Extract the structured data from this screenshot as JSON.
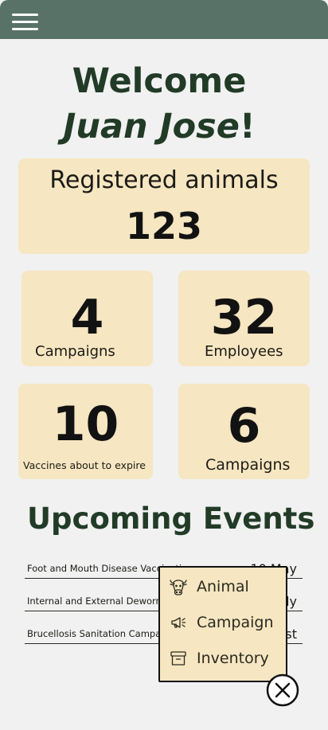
{
  "header": {
    "menu_icon": "hamburger-menu-icon"
  },
  "welcome": {
    "line1": "Welcome",
    "name": "Juan Jose",
    "punct": "!"
  },
  "stats": {
    "registered": {
      "label": "Registered animals",
      "value": "123"
    },
    "campaigns_a": {
      "value": "4",
      "label": "Campaigns"
    },
    "employees": {
      "value": "32",
      "label": "Employees"
    },
    "vaccines": {
      "value": "10",
      "label": "Vaccines about to expire"
    },
    "campaigns_b": {
      "value": "6",
      "label": "Campaigns"
    }
  },
  "events": {
    "title": "Upcoming Events",
    "rows": [
      {
        "name": "Foot and Mouth Disease Vaccination",
        "date": "10 May"
      },
      {
        "name": "Internal and External Deworming",
        "date": "July"
      },
      {
        "name": "Brucellosis Sanitation Campaign",
        "date": "August"
      }
    ]
  },
  "popup": {
    "items": [
      {
        "label": "Animal",
        "icon": "cow-icon"
      },
      {
        "label": "Campaign",
        "icon": "megaphone-icon"
      },
      {
        "label": "Inventory",
        "icon": "archive-box-icon"
      }
    ],
    "close_icon": "close-circle-icon"
  },
  "colors": {
    "header_bg": "#587268",
    "card_bg": "#f6e6c1",
    "heading_green": "#213b27",
    "page_bg": "#f1f1f1"
  }
}
